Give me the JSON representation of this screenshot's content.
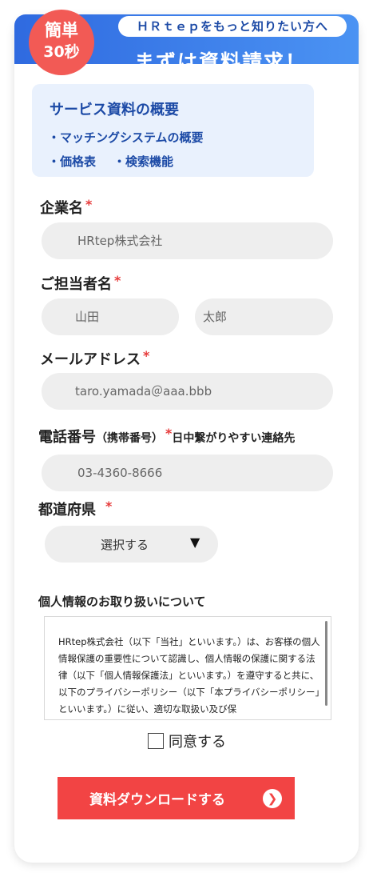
{
  "header": {
    "tagline": "ＨＲｔｅｐをもっと知りたい方へ",
    "title": "まずは資料請求！",
    "badge_line1": "簡単",
    "badge_line2": "30秒"
  },
  "summary": {
    "heading": "サービス資料の概要",
    "item1": "・マッチングシステムの概要",
    "item2": "・価格表",
    "item3": "・検索機能"
  },
  "form": {
    "company": {
      "label": "企業名",
      "required_mark": "*",
      "placeholder": "HRtep株式会社"
    },
    "person": {
      "label": "ご担当者名",
      "required_mark": "*",
      "last_placeholder": "山田",
      "first_placeholder": "太郎"
    },
    "email": {
      "label": "メールアドレス",
      "required_mark": "*",
      "placeholder": "taro.yamada＠aaa.bbb"
    },
    "phone": {
      "label": "電話番号",
      "note1": "（携帯番号）",
      "required_mark": "*",
      "note2": "日中繋がりやすい連絡先",
      "placeholder": "03-4360-8666"
    },
    "prefecture": {
      "label": "都道府県",
      "required_mark": "*",
      "selected": "選択する",
      "arrow": "▼"
    }
  },
  "privacy": {
    "title": "個人情報のお取り扱いについて",
    "text": "HRtep株式会社（以下「当社」といいます。）は、お客様の個人情報保護の重要性について認識し、個人情報の保護に関する法律（以下「個人情報保護法」といいます。）を遵守すると共に、以下のプライバシーポリシー（以下「本プライバシーポリシー」といいます。）に従い、適切な取扱い及び保"
  },
  "agree": {
    "label": "同意する"
  },
  "submit": {
    "label": "資料ダウンロードする",
    "icon": "❯"
  }
}
